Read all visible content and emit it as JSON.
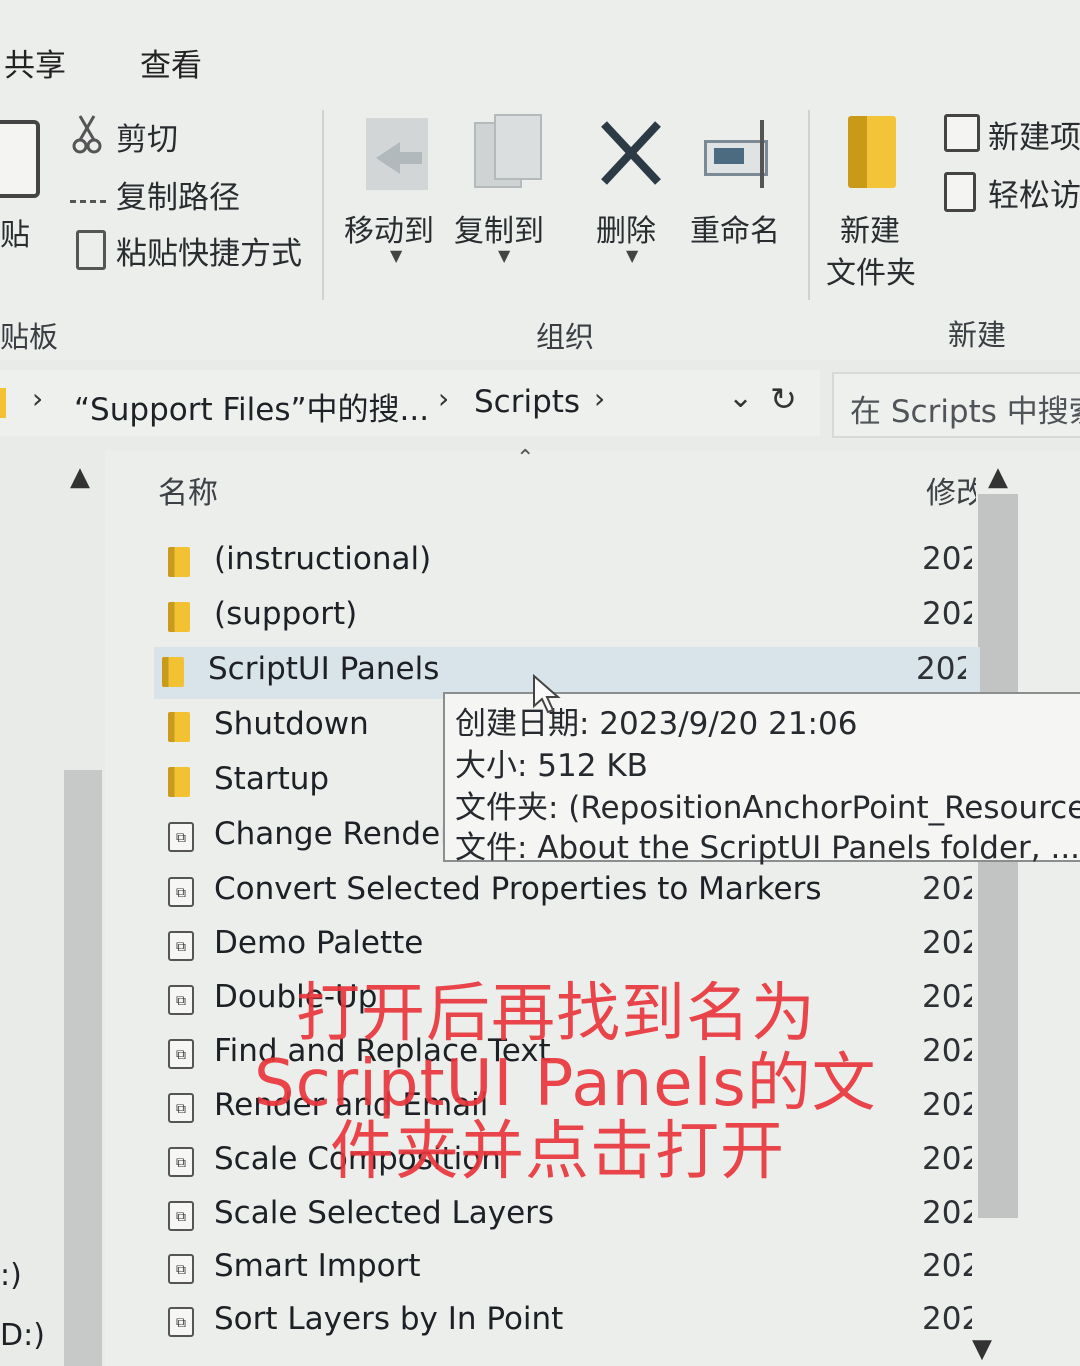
{
  "tabs": {
    "share": "共享",
    "view": "查看"
  },
  "clipboard": {
    "cut": "剪切",
    "copy_path": "复制路径",
    "paste_shortcut": "粘贴快捷方式",
    "paste_fragment": "贴",
    "group_label": "贴板"
  },
  "organize": {
    "move_to": "移动到",
    "copy_to": "复制到",
    "delete": "删除",
    "rename": "重命名",
    "group_label": "组织"
  },
  "new_group": {
    "new_folder_line1": "新建",
    "new_folder_line2": "文件夹",
    "new_item": "新建项",
    "easy_access": "轻松访",
    "group_label": "新建"
  },
  "address": {
    "crumb1": "“Support Files”中的搜...",
    "crumb2": "Scripts",
    "search_placeholder": "在 Scripts 中搜索"
  },
  "columns": {
    "name": "名称",
    "modified": "修改"
  },
  "files": [
    {
      "name": "(instructional)",
      "date": "202",
      "type": "folder"
    },
    {
      "name": "(support)",
      "date": "202",
      "type": "folder"
    },
    {
      "name": "ScriptUI Panels",
      "date": "202",
      "type": "folder"
    },
    {
      "name": "Shutdown",
      "date": "",
      "type": "folder"
    },
    {
      "name": "Startup",
      "date": "",
      "type": "folder"
    },
    {
      "name": "Change Render",
      "date": "",
      "type": "script"
    },
    {
      "name": "Convert Selected Properties to Markers",
      "date": "202",
      "type": "script"
    },
    {
      "name": "Demo Palette",
      "date": "202",
      "type": "script"
    },
    {
      "name": "Double-Up",
      "date": "202",
      "type": "script"
    },
    {
      "name": "Find and Replace Text",
      "date": "202",
      "type": "script"
    },
    {
      "name": "Render and Email",
      "date": "202",
      "type": "script"
    },
    {
      "name": "Scale Composition",
      "date": "202",
      "type": "script"
    },
    {
      "name": "Scale Selected Layers",
      "date": "202",
      "type": "script"
    },
    {
      "name": "Smart Import",
      "date": "202",
      "type": "script"
    },
    {
      "name": "Sort Layers by In Point",
      "date": "202",
      "type": "script"
    }
  ],
  "tooltip": {
    "created": "创建日期: 2023/9/20 21:06",
    "size": "大小: 512 KB",
    "folders": "文件夹: (RepositionAnchorPoint_Resources",
    "files": "文件: About the ScriptUI Panels folder, ..."
  },
  "nav": {
    "drive_c": ":)",
    "drive_d": "D:)"
  },
  "overlay": {
    "line1": "打开后再找到名为",
    "line2": "ScriptUI Panels的文",
    "line3": "件夹并点击打开"
  },
  "colors": {
    "overlay_red": "#e8363c",
    "folder_yellow": "#f2c233",
    "selected_row": "#d9e4ea"
  }
}
